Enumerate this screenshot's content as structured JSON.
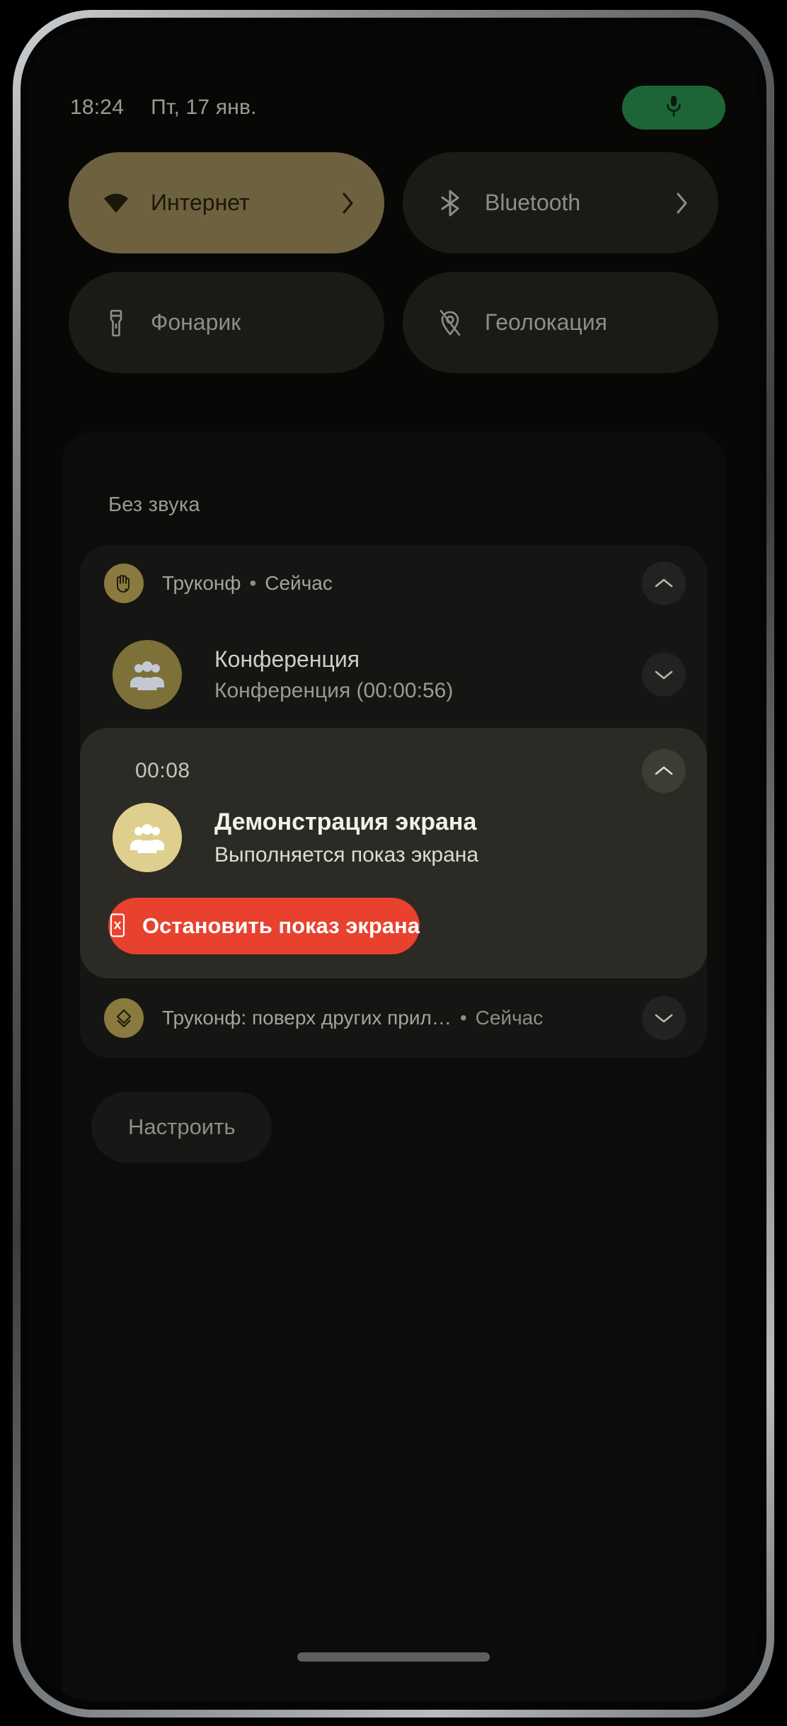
{
  "status_bar": {
    "time": "18:24",
    "date": "Пт, 17 янв.",
    "mic_icon": "microphone-icon",
    "mic_pill_color": "#1d6437"
  },
  "quick_settings": {
    "tiles": [
      {
        "label": "Интернет",
        "icon": "wifi-icon",
        "active": true,
        "has_chevron": true,
        "bg": "#6d6140"
      },
      {
        "label": "Bluetooth",
        "icon": "bluetooth-icon",
        "active": false,
        "has_chevron": true,
        "bg": "#1b1a17"
      },
      {
        "label": "Фонарик",
        "icon": "flashlight-icon",
        "active": false,
        "has_chevron": false,
        "bg": "#1b1a17"
      },
      {
        "label": "Геолокация",
        "icon": "location-off-icon",
        "active": false,
        "has_chevron": false,
        "bg": "#1b1a17"
      }
    ]
  },
  "shade": {
    "section_title": "Без звука",
    "group_header": {
      "app_name": "Труконф",
      "separator": "•",
      "time": "Сейчас",
      "app_icon": "truconf-app-icon",
      "collapse_icon": "chevron-up-icon"
    },
    "conference_notification": {
      "title": "Конференция",
      "subtitle": "Конференция (00:00:56)",
      "avatar_icon": "group-people-icon",
      "expand_icon": "chevron-down-icon"
    },
    "screenshare_notification": {
      "timer": "00:08",
      "title": "Демонстрация экрана",
      "subtitle": "Выполняется показ экрана",
      "avatar_icon": "group-people-icon",
      "collapse_icon": "chevron-up-icon",
      "action_button": {
        "label": "Остановить показ экрана",
        "icon": "phone-stop-icon",
        "color": "#e8412e"
      }
    },
    "overlay_notification": {
      "app_name": "Труконф: поверх других прил…",
      "separator": "•",
      "time": "Сейчас",
      "app_icon": "diamond-icon",
      "expand_icon": "chevron-down-icon"
    },
    "settings_button_label": "Настроить"
  }
}
